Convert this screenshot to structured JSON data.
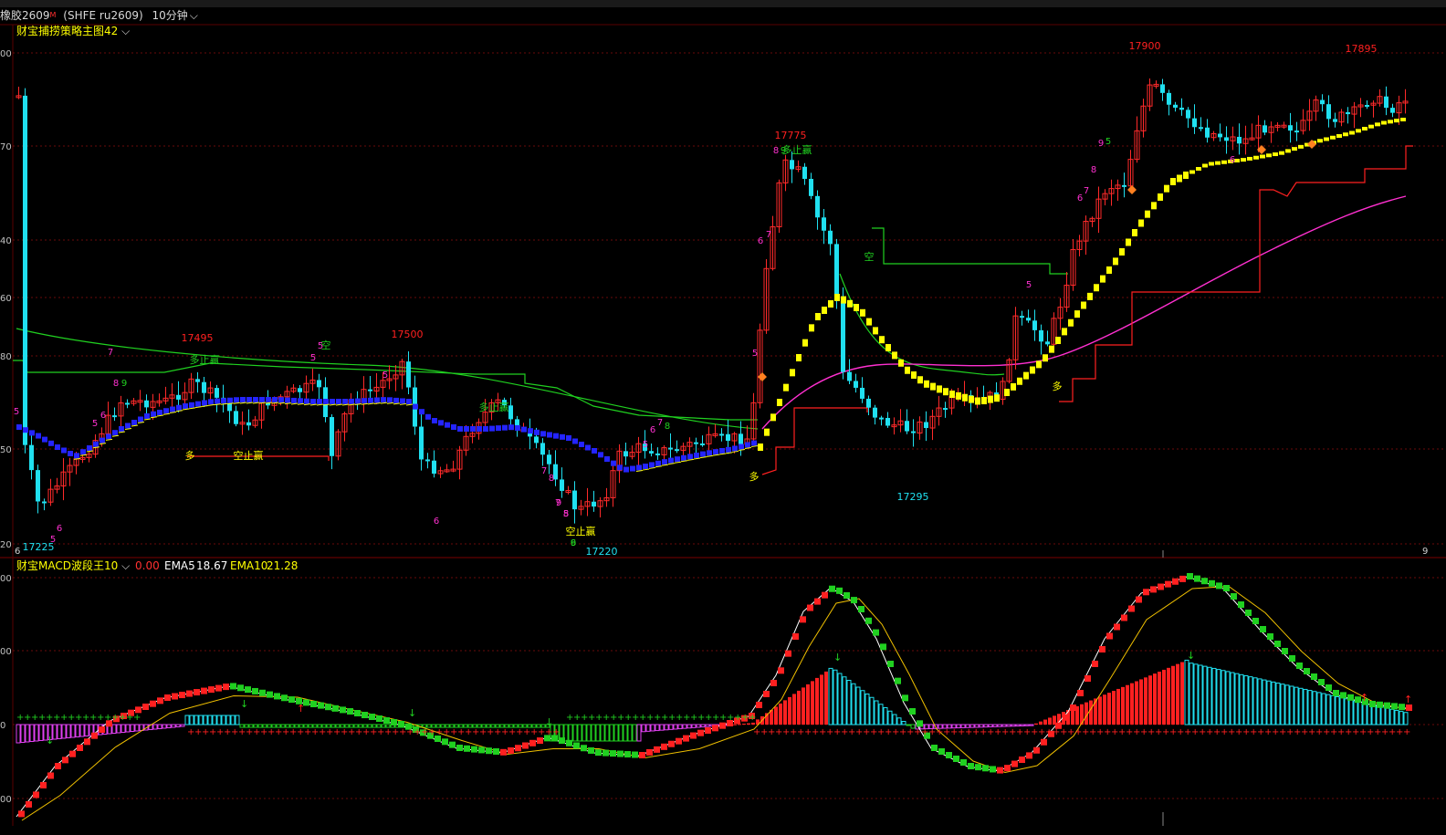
{
  "header": {
    "instrument": "橡胶2609",
    "instrument_sup": "M",
    "code": "(SHFE ru2609)",
    "period": "10分钟"
  },
  "main_panel": {
    "indicator_name": "财宝捕捞策略主图42",
    "y_ticks": [
      "00",
      "70",
      "40",
      "60",
      "80",
      "50",
      "20"
    ],
    "bottom_left_label": "6",
    "bottom_right_label": "9"
  },
  "sub_panel": {
    "indicator_name": "财宝MACD波段王10",
    "value": "0.00",
    "ema5_label": "EMA5",
    "ema5_value": "18.67",
    "ema10_label": "EMA10",
    "ema10_value": "21.28",
    "y_ticks": [
      "00",
      "00",
      "0",
      "00"
    ]
  },
  "colors": {
    "up": "#ff2a2a",
    "down": "#20e0f0",
    "yellow": "#ffff00",
    "blue": "#2424ff",
    "magenta": "#ff30d0",
    "green": "#20d020",
    "red": "#ff2020",
    "grid": "#6a0a0a",
    "purple": "#e040f0"
  },
  "chart_data": [
    {
      "type": "candlestick",
      "title": "",
      "price_labels": [
        {
          "text": "17225",
          "kind": "low"
        },
        {
          "text": "17495",
          "kind": "high"
        },
        {
          "text": "17500",
          "kind": "high"
        },
        {
          "text": "17220",
          "kind": "low"
        },
        {
          "text": "17775",
          "kind": "high"
        },
        {
          "text": "17295",
          "kind": "low"
        },
        {
          "text": "17900",
          "kind": "high"
        },
        {
          "text": "17895",
          "kind": "high"
        }
      ],
      "signal_labels": [
        "多止赢",
        "空止赢",
        "多止赢",
        "多止赢",
        "空止赢",
        "多",
        "多",
        "多",
        "空",
        "空"
      ],
      "count_labels": [
        "5",
        "5",
        "6",
        "7",
        "8",
        "9",
        "6",
        "5",
        "5",
        "5",
        "5",
        "6",
        "7",
        "8",
        "9",
        "5",
        "6",
        "7",
        "8",
        "9",
        "5",
        "6",
        "7",
        "8",
        "6",
        "7",
        "8",
        "9",
        "5",
        "5",
        "6",
        "7",
        "8",
        "9",
        "5",
        "6"
      ],
      "ohlc_close_estimate": [
        17430,
        17300,
        17380,
        17440,
        17470,
        17460,
        17380,
        17480,
        17470,
        17420,
        17400,
        17440,
        17370,
        17300,
        17340,
        17430,
        17700,
        17720,
        17580,
        17400,
        17380,
        17410,
        17560,
        17560,
        17780,
        17860,
        17830,
        17860,
        17830,
        17860
      ]
    },
    {
      "type": "bar",
      "title": "",
      "series": [
        {
          "name": "EMA5",
          "last_value": 18.67
        },
        {
          "name": "EMA10",
          "last_value": 21.28
        }
      ]
    }
  ]
}
